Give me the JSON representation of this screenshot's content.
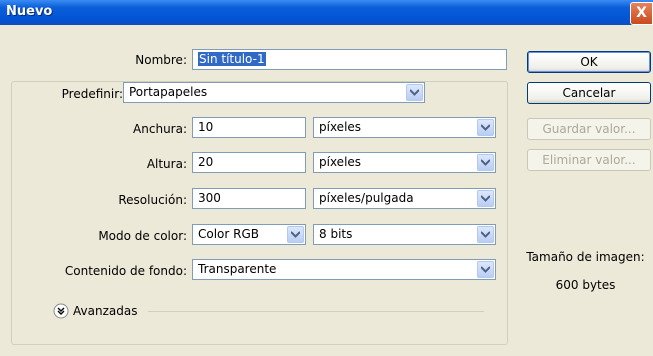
{
  "window": {
    "title": "Nuevo",
    "close_glyph": "X"
  },
  "name": {
    "label": "Nombre:",
    "value": "Sin título-1"
  },
  "preset": {
    "label": "Predefinir:",
    "value": "Portapapeles"
  },
  "width": {
    "label": "Anchura:",
    "value": "10",
    "unit": "píxeles"
  },
  "height": {
    "label": "Altura:",
    "value": "20",
    "unit": "píxeles"
  },
  "resolution": {
    "label": "Resolución:",
    "value": "300",
    "unit": "píxeles/pulgada"
  },
  "color_mode": {
    "label": "Modo de color:",
    "value": "Color RGB",
    "depth": "8 bits"
  },
  "background": {
    "label": "Contenido de fondo:",
    "value": "Transparente"
  },
  "advanced": {
    "label": "Avanzadas"
  },
  "buttons": {
    "ok": "OK",
    "cancel": "Cancelar",
    "save_preset": "Guardar valor...",
    "delete_preset": "Eliminar valor..."
  },
  "image_size": {
    "label": "Tamaño de imagen:",
    "value": "600 bytes"
  },
  "colors": {
    "titlebar": "#0355d6",
    "selection": "#316ac5",
    "dialog_bg": "#ece9d8"
  }
}
